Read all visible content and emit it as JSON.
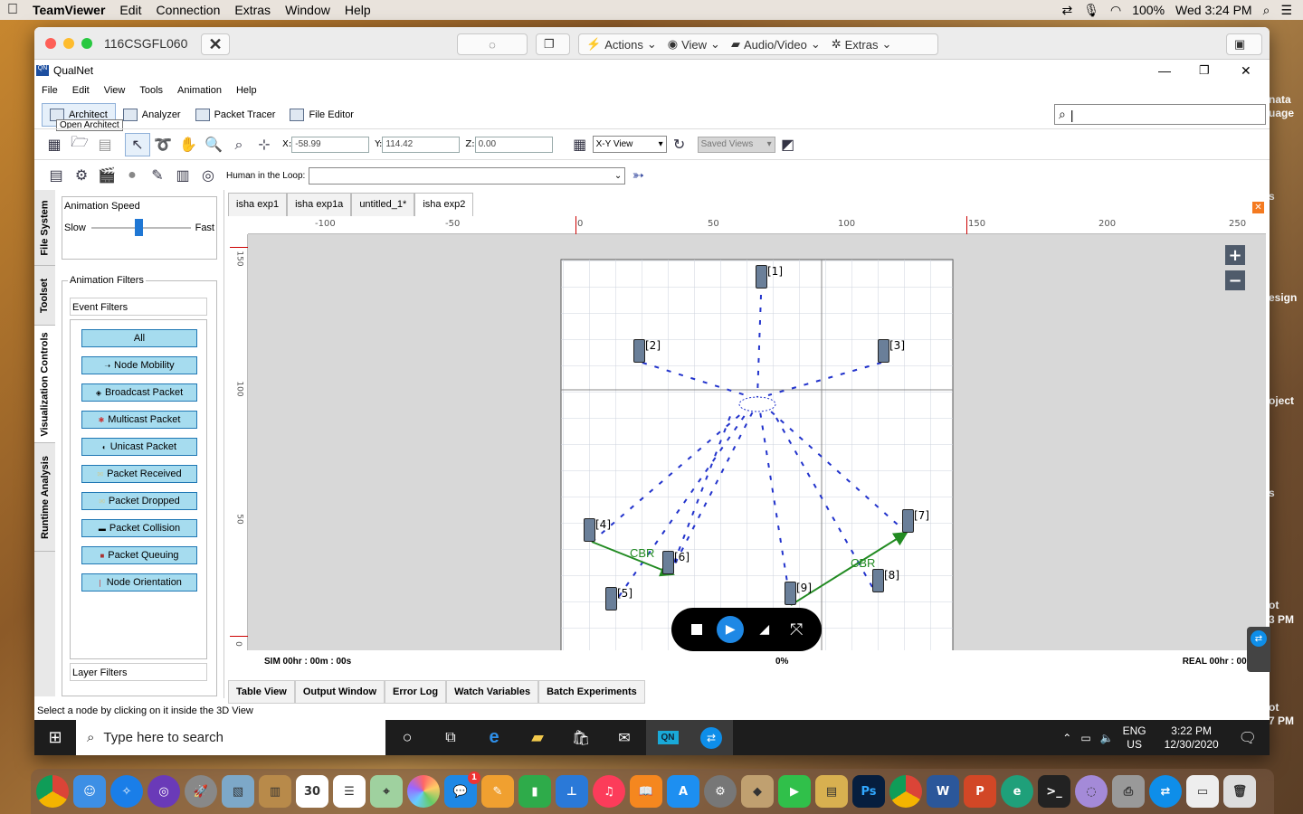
{
  "mac": {
    "app": "TeamViewer",
    "menus": [
      "Edit",
      "Connection",
      "Extras",
      "Window",
      "Help"
    ],
    "battery": "100%",
    "clock": "Wed 3:24 PM"
  },
  "teamviewer": {
    "session_id": "116CSGFL060",
    "buttons": {
      "actions": "Actions",
      "view": "View",
      "audio": "Audio/Video",
      "extras": "Extras"
    }
  },
  "qualnet": {
    "title": "QualNet",
    "menu": [
      "File",
      "Edit",
      "View",
      "Tools",
      "Animation",
      "Help"
    ],
    "tools": [
      "Architect",
      "Analyzer",
      "Packet Tracer",
      "File Editor"
    ],
    "tooltip": "Open Architect",
    "coords": {
      "x_label": "X:",
      "x": "-58.99",
      "y_label": "Y:",
      "y": "114.42",
      "z_label": "Z:",
      "z": "0.00"
    },
    "view_select": "X-Y View",
    "saved_views": "Saved Views",
    "hitl_label": "Human in the Loop:"
  },
  "side_tabs": [
    "File System",
    "Toolset",
    "Visualization Controls",
    "Runtime Analysis"
  ],
  "panel": {
    "speed_title": "Animation Speed",
    "slow": "Slow",
    "fast": "Fast",
    "filters_title": "Animation Filters",
    "event_filters": "Event Filters",
    "layer_filters": "Layer Filters",
    "buttons": [
      "All",
      "Node Mobility",
      "Broadcast Packet",
      "Multicast Packet",
      "Unicast Packet",
      "Packet Received",
      "Packet Dropped",
      "Packet Collision",
      "Packet Queuing",
      "Node Orientation"
    ]
  },
  "tabs": [
    "isha exp1",
    "isha exp1a",
    "untitled_1*",
    "isha exp2"
  ],
  "ruler_x": [
    "-100",
    "-50",
    "0",
    "50",
    "100",
    "150",
    "200",
    "250"
  ],
  "ruler_y": [
    "150",
    "100",
    "50",
    "0"
  ],
  "nodes": [
    "[1]",
    "[2]",
    "[3]",
    "[4]",
    "[5]",
    "[6]",
    "[7]",
    "[8]",
    "[9]"
  ],
  "links": [
    "CBR",
    "CBR"
  ],
  "status": {
    "sim": "SIM 00hr : 00m : 00s",
    "pct": "0%",
    "real": "REAL 00hr : 00m : 0"
  },
  "bottom_tabs": [
    "Table View",
    "Output Window",
    "Error Log",
    "Watch Variables",
    "Batch Experiments"
  ],
  "hint": "Select a node by clicking on it inside the 3D View",
  "windows": {
    "search": "Type here to search",
    "lang1": "ENG",
    "lang2": "US",
    "time": "3:22 PM",
    "date": "12/30/2020"
  },
  "right_edge": [
    "nata",
    "uage",
    "s",
    "esign",
    "oject",
    "s",
    "ot",
    "3 PM",
    "ot",
    "7 PM"
  ],
  "dock_badge": "1",
  "colors": {
    "accent": "#1f77b4",
    "filter_btn": "#a6dcef",
    "wireless": "#2233cc",
    "cbr": "#228b22"
  }
}
